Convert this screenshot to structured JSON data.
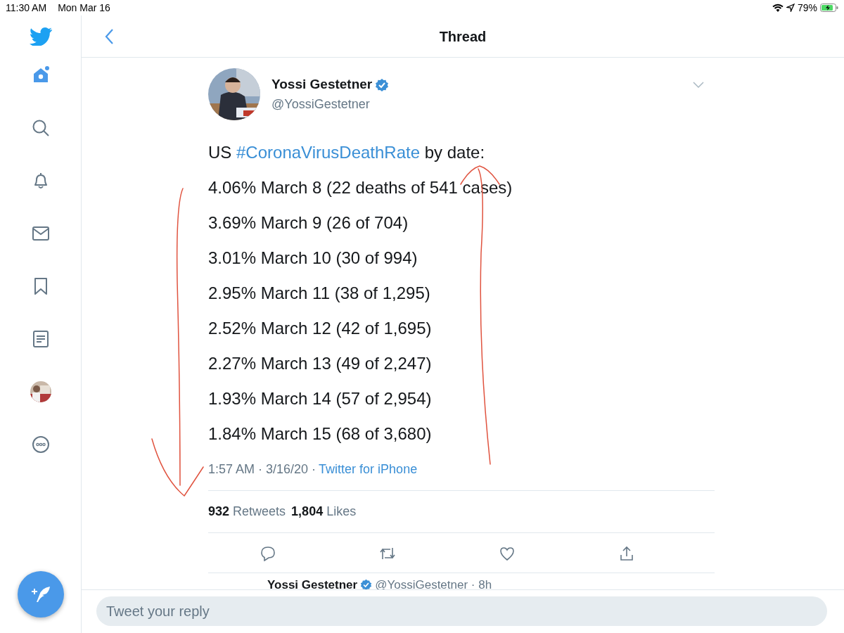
{
  "status_bar": {
    "time": "11:30 AM",
    "date": "Mon Mar 16",
    "battery": "79%"
  },
  "sidebar": {
    "items": [
      {
        "kind": "home",
        "selected": true
      },
      {
        "kind": "search",
        "selected": false
      },
      {
        "kind": "notifications",
        "selected": false
      },
      {
        "kind": "messages",
        "selected": false
      },
      {
        "kind": "bookmarks",
        "selected": false
      },
      {
        "kind": "lists",
        "selected": false
      },
      {
        "kind": "profile",
        "selected": false
      },
      {
        "kind": "more",
        "selected": false
      }
    ]
  },
  "header": {
    "title": "Thread"
  },
  "tweet": {
    "author": "Yossi Gestetner",
    "verified": true,
    "handle": "@YossiGestetner",
    "lines": [
      [
        {
          "kind": "text",
          "text": "US "
        },
        {
          "kind": "hashtag",
          "text": "#CoronaVirusDeathRate"
        },
        {
          "kind": "text",
          "text": " by date:"
        }
      ],
      [
        {
          "kind": "text",
          "text": "4.06% March 8 (22 deaths of 541 cases)"
        }
      ],
      [
        {
          "kind": "text",
          "text": "3.69% March 9 (26 of 704)"
        }
      ],
      [
        {
          "kind": "text",
          "text": "3.01% March 10 (30 of 994)"
        }
      ],
      [
        {
          "kind": "text",
          "text": "2.95% March 11 (38 of 1,295)"
        }
      ],
      [
        {
          "kind": "text",
          "text": "2.52% March 12 (42 of 1,695)"
        }
      ],
      [
        {
          "kind": "text",
          "text": "2.27% March 13 (49 of 2,247)"
        }
      ],
      [
        {
          "kind": "text",
          "text": "1.93% March 14 (57 of 2,954)"
        }
      ],
      [
        {
          "kind": "text",
          "text": "1.84% March 15 (68 of 3,680)"
        }
      ]
    ],
    "timestamp": "1:57 AM · 3/16/20 ·",
    "source": "Twitter for iPhone",
    "stats": [
      {
        "count": "932",
        "label": "Retweets"
      },
      {
        "count": "1,804",
        "label": "Likes"
      }
    ]
  },
  "next_reply": {
    "author": "Yossi Gestetner",
    "verified": true,
    "handle": "@YossiGestetner · 8h"
  },
  "reply_box": {
    "placeholder": "Tweet your reply"
  }
}
